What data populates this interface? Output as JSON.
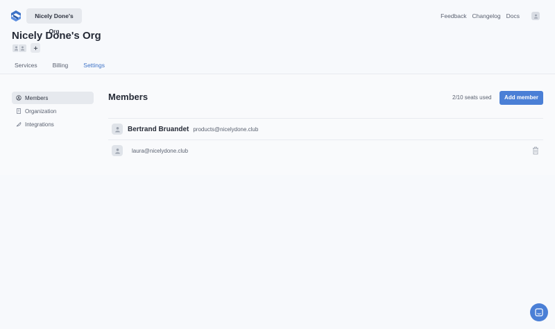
{
  "header": {
    "org_switcher_label": "Nicely Done's Org",
    "links": [
      "Feedback",
      "Changelog",
      "Docs"
    ]
  },
  "page": {
    "title": "Nicely Done's Org"
  },
  "tabs": [
    {
      "label": "Services",
      "active": false
    },
    {
      "label": "Billing",
      "active": false
    },
    {
      "label": "Settings",
      "active": true
    }
  ],
  "sidebar": {
    "items": [
      {
        "label": "Members",
        "icon": "members-icon",
        "active": true
      },
      {
        "label": "Organization",
        "icon": "building-icon",
        "active": false
      },
      {
        "label": "Integrations",
        "icon": "feather-icon",
        "active": false
      }
    ]
  },
  "members": {
    "title": "Members",
    "seats_text": "2/10 seats used",
    "add_label": "Add member",
    "list": [
      {
        "name": "Bertrand Bruandet",
        "email": "products@nicelydone.club",
        "deletable": false
      },
      {
        "name": "",
        "email": "laura@nicelydone.club",
        "deletable": true
      }
    ]
  },
  "colors": {
    "accent": "#4a7fd6",
    "tab_active": "#3e73c7",
    "background": "#f7f9fc"
  }
}
